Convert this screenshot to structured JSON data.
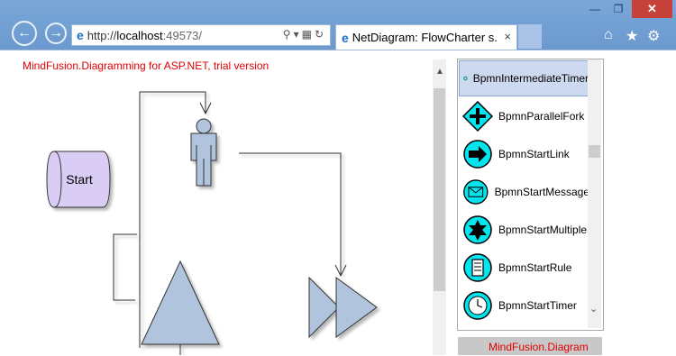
{
  "browser": {
    "back_icon": "back-arrow-icon",
    "forward_icon": "forward-arrow-icon",
    "address": {
      "protocol": "http://",
      "host": "localhost",
      "port": ":49573/"
    },
    "tab_title": "NetDiagram: FlowCharter s...",
    "tab_close": "×",
    "window": {
      "minimize": "—",
      "restore": "❐",
      "close": "✕"
    },
    "right_icons": [
      "home-icon",
      "favorites-star-icon",
      "settings-gear-icon"
    ]
  },
  "page": {
    "trial_notice": "MindFusion.Diagramming for ASP.NET, trial version",
    "overview_notice": "MindFusion.Diagram"
  },
  "diagram": {
    "start_label": "Start"
  },
  "palette": {
    "items": [
      {
        "label": "BpmnIntermediateTimer",
        "icon": "bpmn-intermediate-timer-icon",
        "selected": true
      },
      {
        "label": "BpmnParallelFork",
        "icon": "bpmn-parallel-fork-icon",
        "selected": false
      },
      {
        "label": "BpmnStartLink",
        "icon": "bpmn-start-link-icon",
        "selected": false
      },
      {
        "label": "BpmnStartMessage",
        "icon": "bpmn-start-message-icon",
        "selected": false
      },
      {
        "label": "BpmnStartMultiple",
        "icon": "bpmn-start-multiple-icon",
        "selected": false
      },
      {
        "label": "BpmnStartRule",
        "icon": "bpmn-start-rule-icon",
        "selected": false
      },
      {
        "label": "BpmnStartTimer",
        "icon": "bpmn-start-timer-icon",
        "selected": false
      }
    ]
  },
  "colors": {
    "accent": "#e00000",
    "shape_fill": "#b0c4de",
    "palette_icon_fill": "#00e5ee",
    "selection": "#cdd9ee"
  }
}
